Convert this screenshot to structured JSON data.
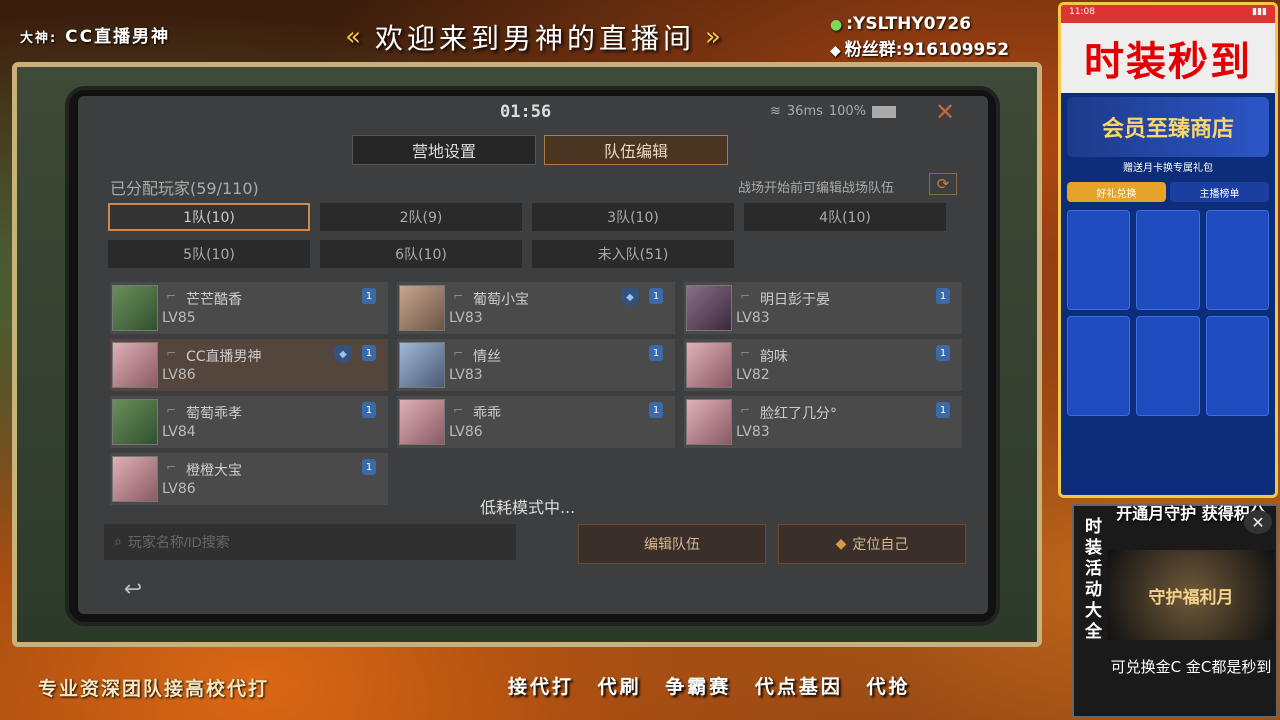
{
  "stream": {
    "streamer_label": "大神:",
    "streamer_name": "CC直播男神",
    "title": "欢迎来到男神的直播间",
    "wechat": ":YSLTHY0726",
    "fan_group": "粉丝群:916109952",
    "bottom_left": "专业资深团队接高校代打",
    "bottom_right": "接代打 代刷 争霸赛 代点基因 代抢"
  },
  "game": {
    "timer": "01:56",
    "ping": "36ms",
    "battery": "100%",
    "tabs": [
      {
        "label": "营地设置"
      },
      {
        "label": "队伍编辑"
      }
    ],
    "assigned": "已分配玩家(59/110)",
    "edit_hint": "战场开始前可编辑战场队伍",
    "teams": [
      {
        "label": "1队(10)"
      },
      {
        "label": "2队(9)"
      },
      {
        "label": "3队(10)"
      },
      {
        "label": "4队(10)"
      },
      {
        "label": "5队(10)"
      },
      {
        "label": "6队(10)"
      },
      {
        "label": "未入队(51)"
      }
    ],
    "players": [
      {
        "name": "芒芒酷香",
        "level": "LV85",
        "badge": "1"
      },
      {
        "name": "葡萄小宝",
        "level": "LV83",
        "badge": "1"
      },
      {
        "name": "明日彭于晏",
        "level": "LV83",
        "badge": "1"
      },
      {
        "name": "CC直播男神",
        "level": "LV86",
        "badge": "1"
      },
      {
        "name": "情丝",
        "level": "LV83",
        "badge": "1"
      },
      {
        "name": "韵味",
        "level": "LV82",
        "badge": "1"
      },
      {
        "name": "萄萄乖孝",
        "level": "LV84",
        "badge": "1"
      },
      {
        "name": "乖乖",
        "level": "LV86",
        "badge": "1"
      },
      {
        "name": "脸红了几分°",
        "level": "LV83",
        "badge": "1"
      },
      {
        "name": "橙橙大宝",
        "level": "LV86",
        "badge": "1"
      }
    ],
    "low_power": "低耗模式中...",
    "search_placeholder": "玩家名称/ID搜索",
    "edit_team_btn": "编辑队伍",
    "locate_btn": "定位自己"
  },
  "phone": {
    "time": "11:08",
    "promo": "时装秒到",
    "shop_title": "会员至臻商店",
    "shop_sub": "赠送月卡换专属礼包",
    "tab_exchange": "好礼兑换",
    "tab_rank": "主播榜单"
  },
  "ad": {
    "side": "时装活动大全",
    "top": "开通月守护 获得积分",
    "image_text": "守护福利月",
    "bottom": "可兑换金C 金C都是秒到"
  }
}
